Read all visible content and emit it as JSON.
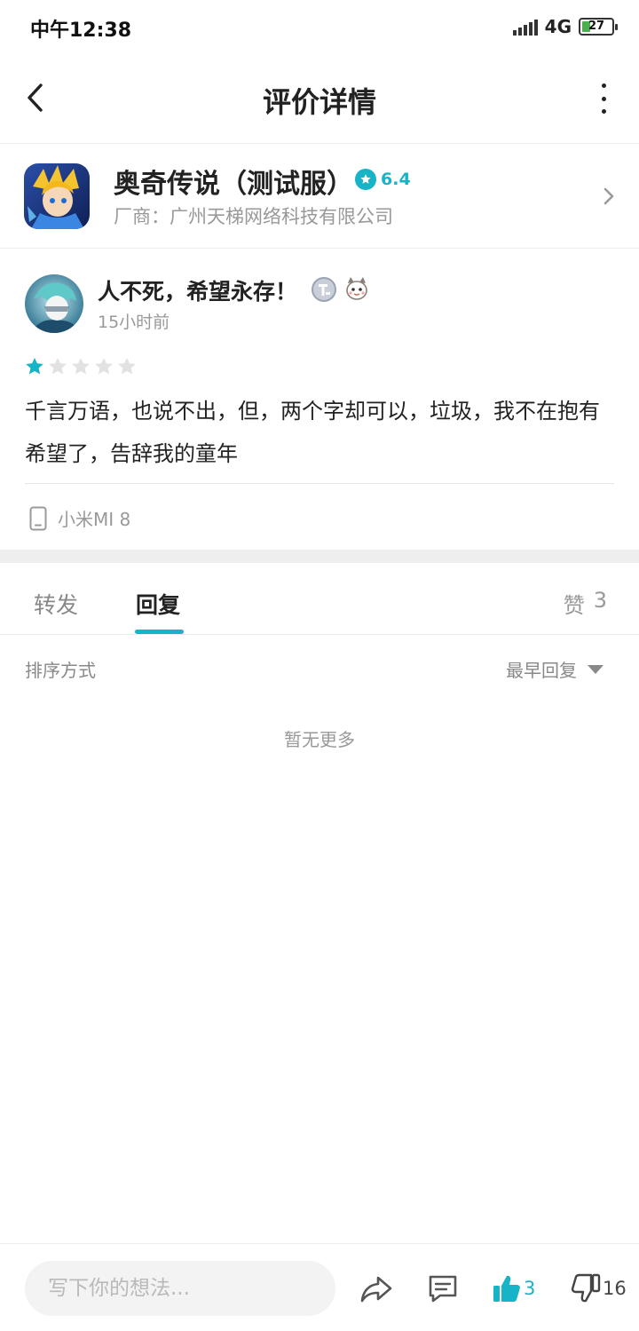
{
  "status_bar": {
    "time": "中午12:38",
    "network": "4G",
    "battery": "27",
    "battery_level": 0.27
  },
  "nav": {
    "title": "评价详情"
  },
  "app": {
    "name": "奥奇传说（测试服）",
    "rating": "6.4",
    "vendor": "厂商：广州天梯网络科技有限公司"
  },
  "review": {
    "author": "人不死，希望永存！",
    "time": "15小时前",
    "stars_filled": 1,
    "stars_total": 5,
    "text": "千言万语，也说不出，但，两个字却可以，垃圾，我不在抱有希望了，告辞我的童年",
    "device": "小米MI 8"
  },
  "tabs": {
    "forward": "转发",
    "reply": "回复",
    "likes_label": "赞",
    "likes_count": "3"
  },
  "sort": {
    "label": "排序方式",
    "value": "最早回复"
  },
  "empty_hint": "暂无更多",
  "bottom_bar": {
    "input_placeholder": "写下你的想法...",
    "like_count": "3",
    "dislike_count": "16"
  },
  "colors": {
    "accent": "#17b3c6",
    "text": "#222222",
    "muted": "#999999"
  }
}
